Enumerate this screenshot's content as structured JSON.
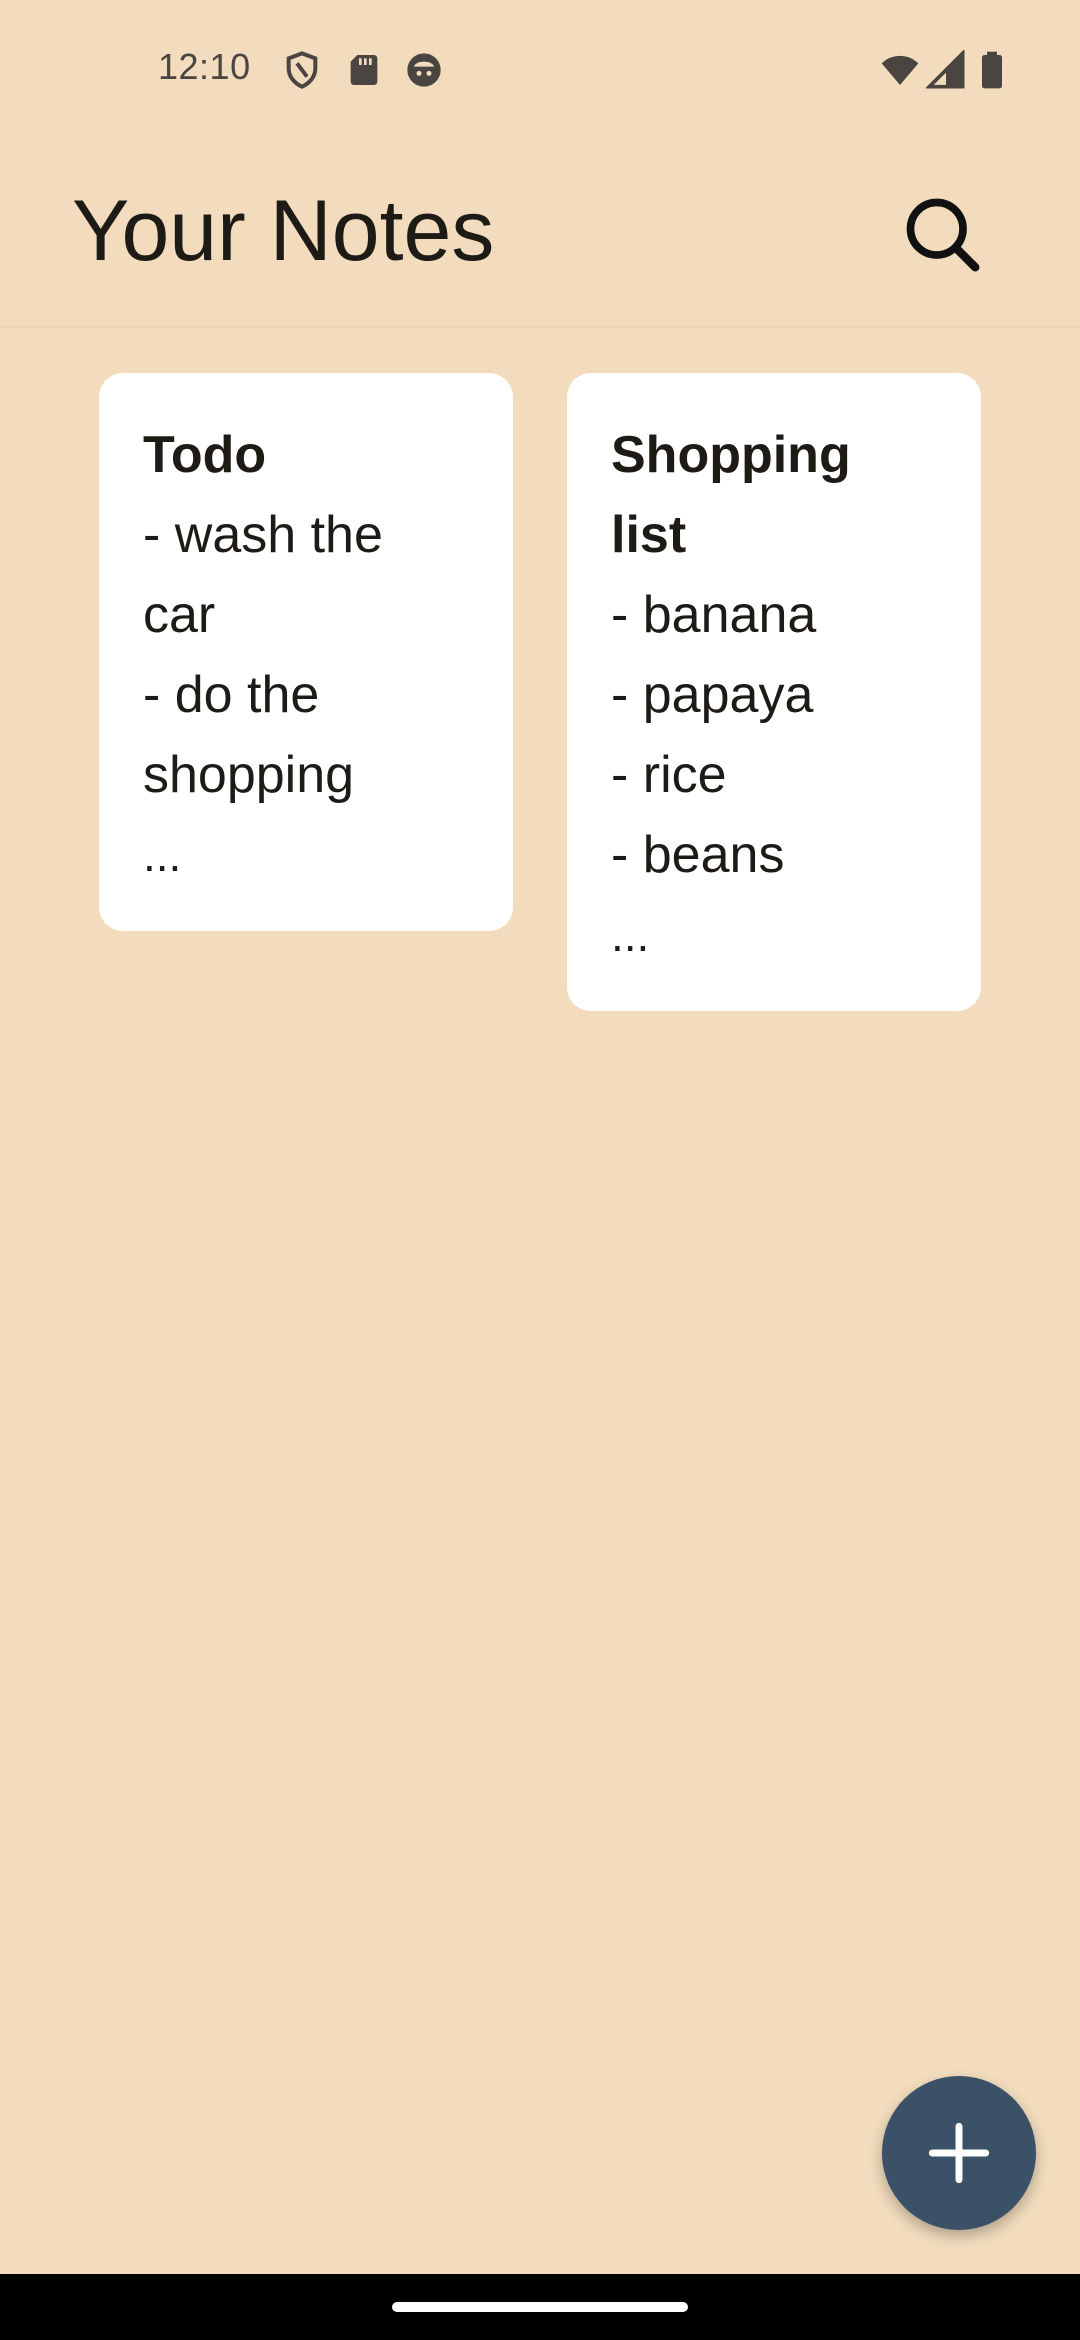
{
  "status_bar": {
    "time": "12:10",
    "left_icons": [
      "shield-icon",
      "sd-card-icon",
      "android-face-icon"
    ],
    "right_icons": [
      "wifi-icon",
      "signal-icon",
      "battery-icon"
    ]
  },
  "app_bar": {
    "title": "Your Notes",
    "search_icon": "search-icon"
  },
  "notes": [
    {
      "title": "Todo",
      "lines": [
        "- wash the",
        "car",
        "- do the",
        "shopping"
      ],
      "more": "..."
    },
    {
      "title_lines": [
        "Shopping",
        "list"
      ],
      "lines": [
        "- banana",
        "- papaya",
        "- rice",
        "- beans"
      ],
      "more": "..."
    }
  ],
  "fab": {
    "icon": "plus-icon"
  },
  "colors": {
    "background": "#F2DCBD",
    "card": "#FFFFFF",
    "fab": "#3A5168",
    "text": "#1E1B17"
  }
}
